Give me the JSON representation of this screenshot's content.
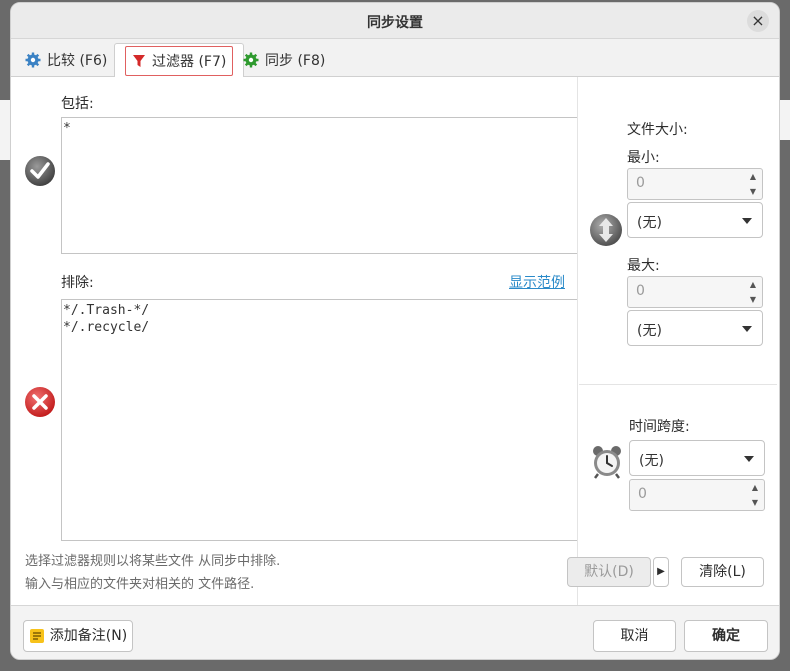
{
  "window": {
    "title": "同步设置",
    "close_glyph": "×"
  },
  "tabs": [
    {
      "label": "比较 (F6)",
      "icon": "gear-blue-icon",
      "active": false
    },
    {
      "label": "过滤器 (F7)",
      "icon": "filter-funnel-icon",
      "active": true
    },
    {
      "label": "同步 (F8)",
      "icon": "gear-green-icon",
      "active": false
    }
  ],
  "filter": {
    "include_label": "包括:",
    "include_value": "*",
    "exclude_label": "排除:",
    "exclude_value": "*/.Trash-*/\n*/.recycle/",
    "show_examples_link": "显示范例",
    "hint_line1": "选择过滤器规则以将某些文件 从同步中排除.",
    "hint_line2": "输入与相应的文件夹对相关的 文件路径."
  },
  "size": {
    "label": "文件大小:",
    "min_label": "最小:",
    "min_value": "0",
    "min_unit": "(无)",
    "max_label": "最大:",
    "max_value": "0",
    "max_unit": "(无)"
  },
  "time": {
    "label": "时间跨度:",
    "unit": "(无)",
    "value": "0"
  },
  "buttons": {
    "default_label": "默认(D)",
    "clear_label": "清除(L)",
    "add_note_label": "添加备注(N)",
    "cancel_label": "取消",
    "ok_label": "确定"
  },
  "colors": {
    "accent_red": "#e04040",
    "link_blue": "#2a8ac9",
    "green": "#2e9a2e"
  }
}
